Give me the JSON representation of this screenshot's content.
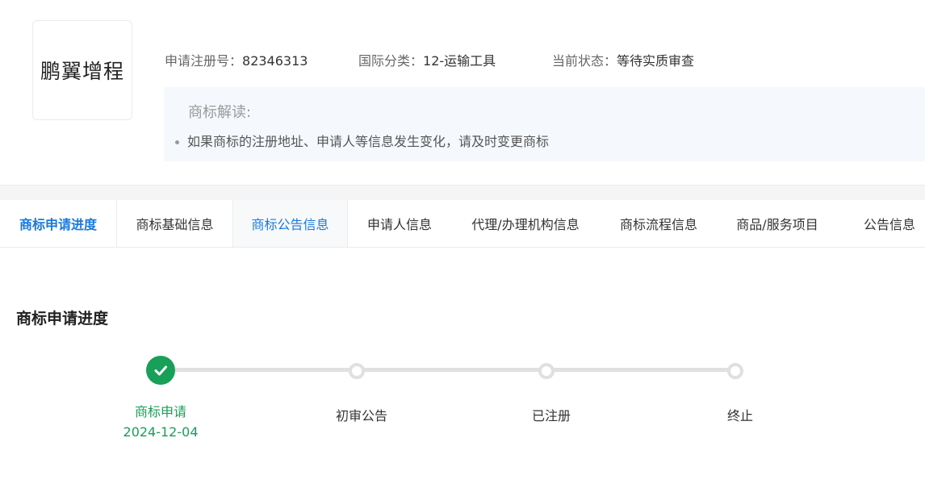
{
  "logo": {
    "text": "鹏翼增程"
  },
  "meta": {
    "reg_label": "申请注册号：",
    "reg_value": "82346313",
    "class_label": "国际分类：",
    "class_value": "12-运输工具",
    "status_label": "当前状态：",
    "status_value": "等待实质审查"
  },
  "interpretation": {
    "title": "商标解读:",
    "item": "如果商标的注册地址、申请人等信息发生变化，请及时变更商标"
  },
  "tabs": [
    {
      "label": "商标申请进度"
    },
    {
      "label": "商标基础信息"
    },
    {
      "label": "商标公告信息"
    },
    {
      "label": "申请人信息"
    },
    {
      "label": "代理/办理机构信息"
    },
    {
      "label": "商标流程信息"
    },
    {
      "label": "商品/服务项目"
    },
    {
      "label": "公告信息"
    }
  ],
  "progress": {
    "title": "商标申请进度",
    "steps": [
      {
        "label": "商标申请",
        "date": "2024-12-04",
        "status": "done"
      },
      {
        "label": "初审公告",
        "status": "pending"
      },
      {
        "label": "已注册",
        "status": "pending"
      },
      {
        "label": "终止",
        "status": "pending"
      }
    ]
  },
  "colors": {
    "accent": "#1a7ae0",
    "success": "#18a058"
  }
}
